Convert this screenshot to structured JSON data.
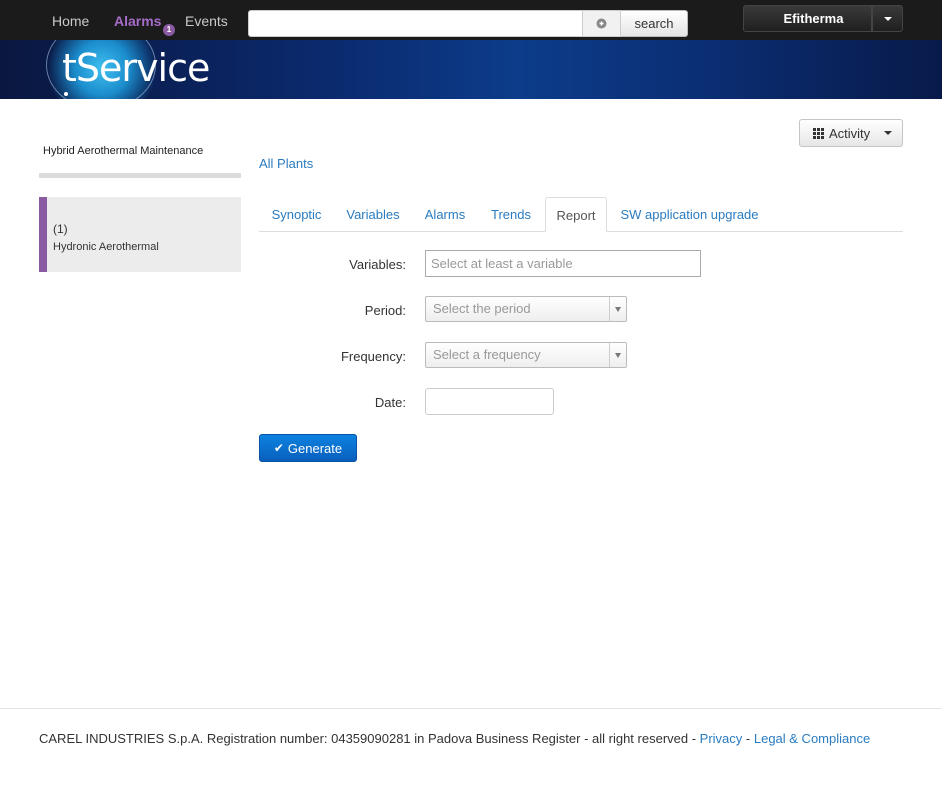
{
  "topbar": {
    "home": "Home",
    "alarms": "Alarms",
    "alarm_count": "1",
    "events": "Events",
    "search_placeholder": "",
    "search_button": "search",
    "user_name": "Efitherma"
  },
  "banner": {
    "logo": "tService"
  },
  "sidebar": {
    "title": "Hybrid Aerothermal Maintenance",
    "plants": [
      {
        "count": "(1)",
        "name": "Hydronic Aerothermal",
        "accent": "#8a5aa3"
      }
    ]
  },
  "activity_button": "Activity",
  "all_plants": "All Plants",
  "tabs": [
    {
      "label": "Synoptic"
    },
    {
      "label": "Variables"
    },
    {
      "label": "Alarms"
    },
    {
      "label": "Trends"
    },
    {
      "label": "Report",
      "active": true
    },
    {
      "label": "SW application upgrade"
    }
  ],
  "form": {
    "variables_label": "Variables:",
    "variables_placeholder": "Select at least a variable",
    "period_label": "Period:",
    "period_value": "Select the period",
    "frequency_label": "Frequency:",
    "frequency_value": "Select a frequency",
    "date_label": "Date:",
    "date_value": ""
  },
  "generate_button": "Generate",
  "footer": {
    "text": "CAREL INDUSTRIES S.p.A. Registration number: 04359090281 in Padova Business Register - all right reserved - ",
    "privacy": "Privacy",
    "separator": " - ",
    "legal": "Legal & Compliance"
  },
  "colors": {
    "accent_purple": "#8a5aa3",
    "link_blue": "#2a7bbf",
    "primary_button": "#0a6fd0",
    "navbar": "#1b1b1b"
  }
}
